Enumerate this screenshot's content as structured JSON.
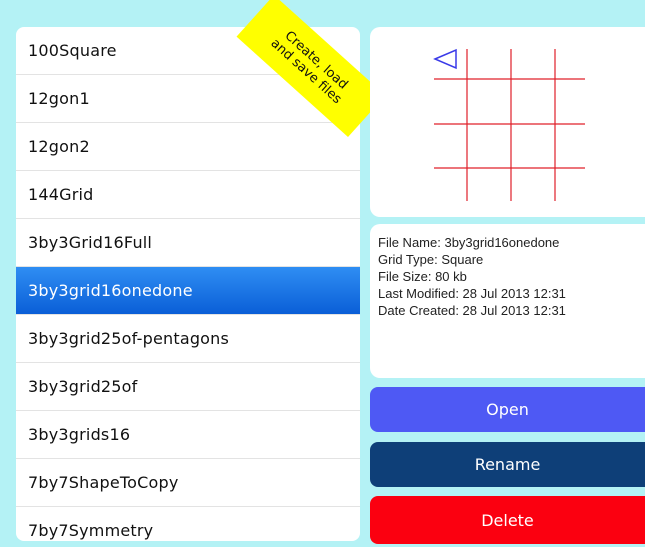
{
  "files": [
    "100Square",
    "12gon1",
    "12gon2",
    "144Grid",
    "3by3Grid16Full",
    "3by3grid16onedone",
    "3by3grid25of-pentagons",
    "3by3grid25of",
    "3by3grids16",
    "7by7ShapeToCopy",
    "7by7Symmetry"
  ],
  "selected_index": 5,
  "ribbon": {
    "line1": "Create, load",
    "line2": "and save files"
  },
  "info": {
    "file_name": "File Name: 3by3grid16onedone",
    "grid_type": "Grid Type: Square",
    "file_size": "File Size: 80 kb",
    "last_modified": "Last Modified: 28 Jul 2013 12:31",
    "date_created": "Date Created: 28 Jul 2013 12:31"
  },
  "buttons": {
    "open": "Open",
    "rename": "Rename",
    "delete": "Delete"
  },
  "colors": {
    "background": "#b4f2f5",
    "grid_lines": "#e0202a",
    "arrow": "#3a3ae8",
    "selected_row": "#1a78e6",
    "open_button": "#4e59f4",
    "rename_button": "#0e3f78",
    "delete_button": "#fb0010",
    "ribbon": "#ffff00"
  },
  "icons": {
    "preview_marker": "triangle-left-outline-icon"
  }
}
